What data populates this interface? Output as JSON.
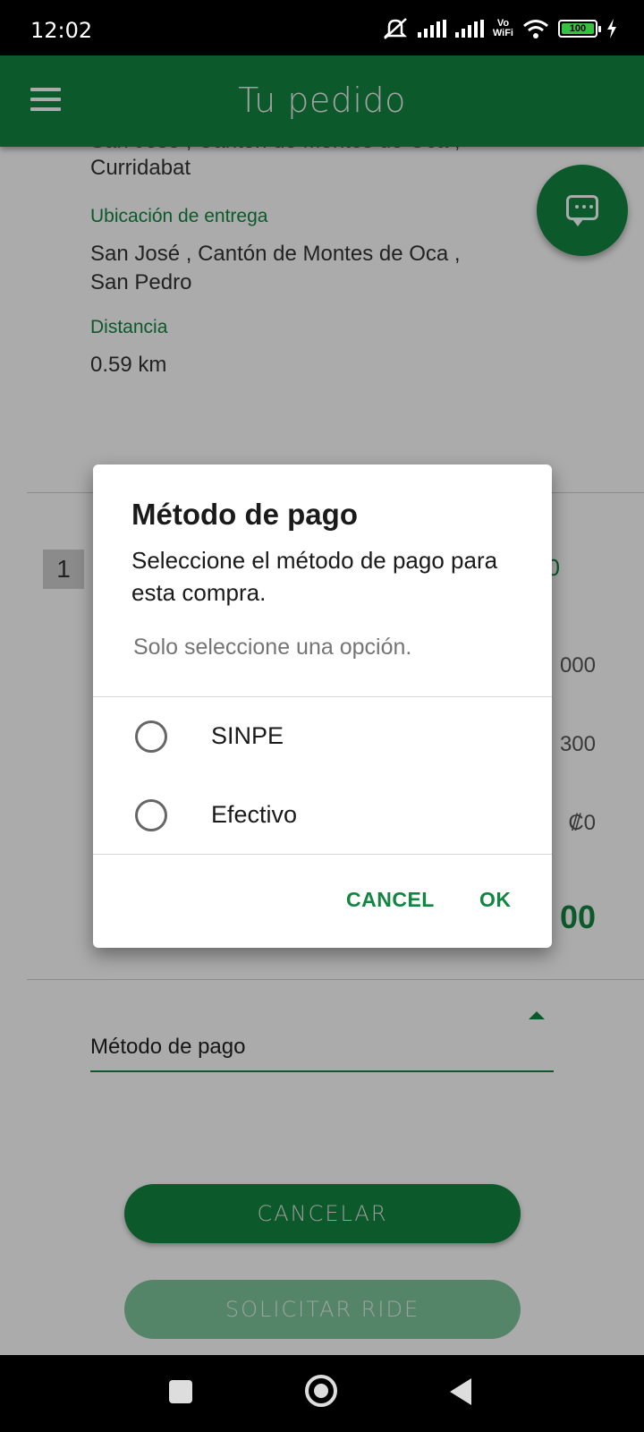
{
  "status_bar": {
    "time": "12:02",
    "battery": "100"
  },
  "app_bar": {
    "title": "Tu pedido"
  },
  "route": {
    "origin_line1_partial": "San José , Cantón de Montes de Oca ,",
    "origin_line2": "Curridabat",
    "delivery_label": "Ubicación de entrega",
    "delivery_line1": "San José , Cantón de Montes de Oca ,",
    "delivery_line2": "San Pedro",
    "distance_label": "Distancia",
    "distance_value": "0.59 km"
  },
  "order": {
    "quantity": "1",
    "partial_green_value": "0",
    "row_values": [
      "000",
      "300",
      "₡0"
    ],
    "total_partial": "00"
  },
  "payment_select": {
    "label": "Método de pago"
  },
  "buttons": {
    "cancel": "CANCELAR",
    "request": "SOLICITAR RIDE"
  },
  "dialog": {
    "title": "Método de pago",
    "subtitle": "Seleccione el método de pago para esta compra.",
    "hint": "Solo seleccione una opción.",
    "options": [
      {
        "label": "SINPE",
        "selected": false
      },
      {
        "label": "Efectivo",
        "selected": false
      }
    ],
    "cancel": "CANCEL",
    "ok": "OK"
  },
  "colors": {
    "brand": "#128540",
    "brand_light": "#7fc69b"
  }
}
